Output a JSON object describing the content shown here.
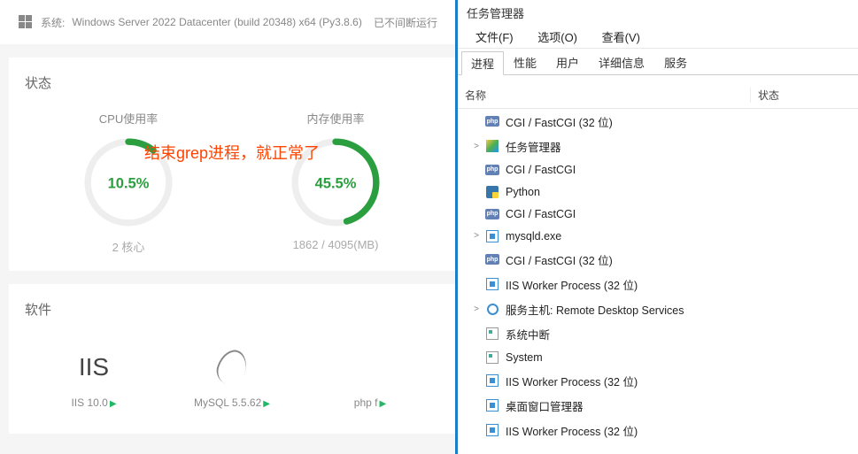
{
  "header": {
    "system_label": "系统:",
    "system_value": "Windows Server 2022 Datacenter (build 20348) x64 (Py3.8.6)",
    "uptime_label": "已不间断运行"
  },
  "status": {
    "title": "状态",
    "cpu": {
      "label": "CPU使用率",
      "value": "10.5%",
      "pct": 10.5,
      "sub": "2 核心"
    },
    "mem": {
      "label": "内存使用率",
      "value": "45.5%",
      "pct": 45.5,
      "sub": "1862 / 4095(MB)"
    }
  },
  "annotation": "结束grep进程，就正常了",
  "software": {
    "title": "软件",
    "items": [
      {
        "logo": "IIS",
        "name": "IIS 10.0"
      },
      {
        "logo": "mysql",
        "name": "MySQL 5.5.62"
      },
      {
        "logo": "",
        "name": "php f"
      }
    ]
  },
  "tm": {
    "title": "任务管理器",
    "menu": {
      "file": "文件(F)",
      "options": "选项(O)",
      "view": "查看(V)"
    },
    "tabs": [
      "进程",
      "性能",
      "用户",
      "详细信息",
      "服务"
    ],
    "active_tab": 0,
    "cols": {
      "name": "名称",
      "status": "状态"
    },
    "procs": [
      {
        "exp": "",
        "icon": "php",
        "name": "CGI / FastCGI (32 位)"
      },
      {
        "exp": ">",
        "icon": "tm",
        "name": "任务管理器"
      },
      {
        "exp": "",
        "icon": "php",
        "name": "CGI / FastCGI"
      },
      {
        "exp": "",
        "icon": "py",
        "name": "Python"
      },
      {
        "exp": "",
        "icon": "php",
        "name": "CGI / FastCGI"
      },
      {
        "exp": ">",
        "icon": "iis",
        "name": "mysqld.exe"
      },
      {
        "exp": "",
        "icon": "php",
        "name": "CGI / FastCGI (32 位)"
      },
      {
        "exp": "",
        "icon": "iis",
        "name": "IIS Worker Process (32 位)"
      },
      {
        "exp": ">",
        "icon": "gear",
        "name": "服务主机: Remote Desktop Services"
      },
      {
        "exp": "",
        "icon": "sys",
        "name": "系统中断"
      },
      {
        "exp": "",
        "icon": "sys",
        "name": "System"
      },
      {
        "exp": "",
        "icon": "iis",
        "name": "IIS Worker Process (32 位)"
      },
      {
        "exp": "",
        "icon": "iis",
        "name": "桌面窗口管理器"
      },
      {
        "exp": "",
        "icon": "iis",
        "name": "IIS Worker Process (32 位)"
      }
    ]
  }
}
